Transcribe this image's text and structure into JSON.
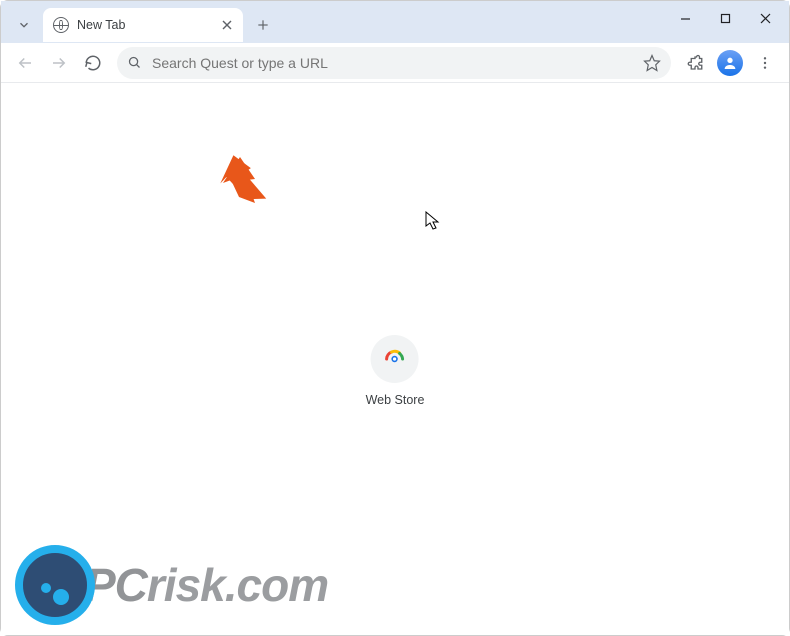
{
  "tab": {
    "title": "New Tab"
  },
  "omnibox": {
    "placeholder": "Search Quest or type a URL"
  },
  "shortcut": {
    "label": "Web Store"
  },
  "watermark": {
    "text_pc": "PC",
    "text_risk": "risk.com"
  }
}
